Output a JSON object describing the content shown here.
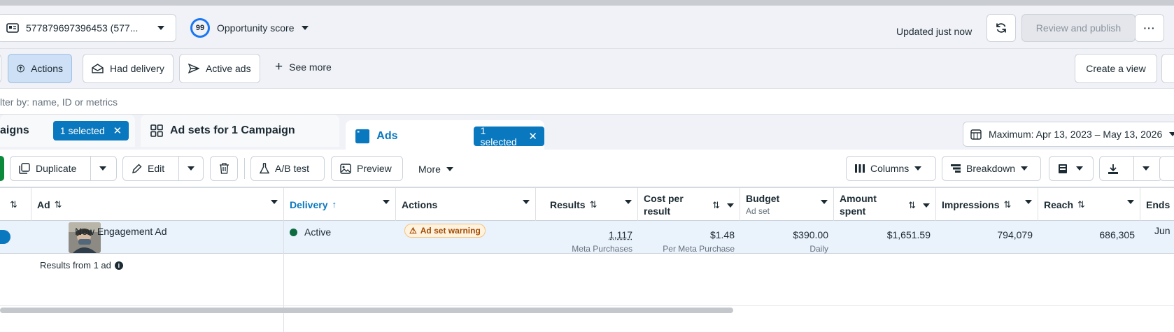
{
  "header": {
    "account_label": "577879697396453 (577...",
    "opportunity_score": "99",
    "opportunity_label": "Opportunity score",
    "updated_text": "Updated just now",
    "review_publish_label": "Review and publish"
  },
  "filters": {
    "items": [
      {
        "label": "Actions"
      },
      {
        "label": "Had delivery"
      },
      {
        "label": "Active ads"
      }
    ],
    "see_more_label": "See more",
    "create_view_label": "Create a view"
  },
  "search": {
    "placeholder": "lter by: name, ID or metrics"
  },
  "tabs": {
    "campaigns_label": "aigns",
    "campaigns_selected": "1 selected",
    "adsets_label": "Ad sets for 1 Campaign",
    "ads_label": "Ads",
    "ads_selected": "1 selected",
    "date_range": "Maximum: Apr 13, 2023 – May 13, 2026"
  },
  "toolbar": {
    "duplicate_label": "Duplicate",
    "edit_label": "Edit",
    "ab_test_label": "A/B test",
    "preview_label": "Preview",
    "more_label": "More",
    "columns_label": "Columns",
    "breakdown_label": "Breakdown"
  },
  "table": {
    "columns": {
      "ad": "Ad",
      "delivery": "Delivery",
      "actions": "Actions",
      "results": "Results",
      "cost_per_result_1": "Cost per",
      "cost_per_result_2": "result",
      "budget": "Budget",
      "budget_sub": "Ad set",
      "amount_spent_1": "Amount",
      "amount_spent_2": "spent",
      "impressions": "Impressions",
      "reach": "Reach",
      "ends": "Ends"
    },
    "row": {
      "ad_name": "New Engagement Ad",
      "delivery": "Active",
      "actions_warning": "Ad set warning",
      "results": "1,117",
      "results_sub": "Meta Purchases",
      "cost_per_result": "$1.48",
      "cost_per_result_sub": "Per Meta Purchase",
      "budget": "$390.00",
      "budget_sub": "Daily",
      "amount_spent": "$1,651.59",
      "impressions": "794,079",
      "reach": "686,305",
      "ends": "Jun"
    },
    "summary_text": "Results from 1 ad"
  },
  "colors": {
    "accent": "#0a78be",
    "active_status": "#0c6b3f",
    "warning": "#a24a00"
  }
}
